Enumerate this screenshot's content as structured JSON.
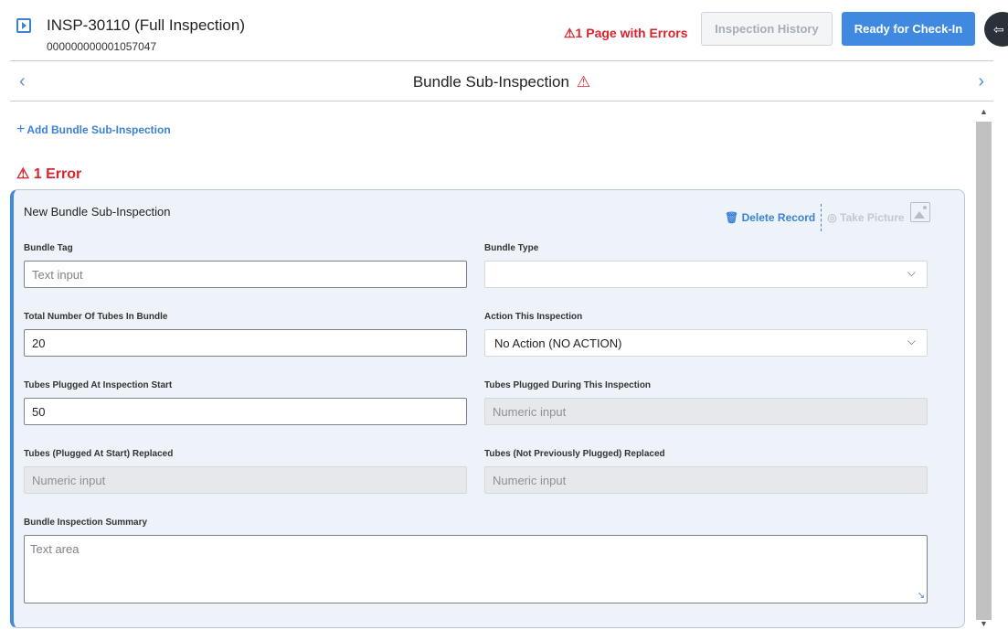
{
  "header": {
    "title": "INSP-30110 (Full Inspection)",
    "subtitle": "000000000001057047",
    "error_summary": "⚠1 Page with Errors",
    "history_button": "Inspection History",
    "ready_button": "Ready for Check-In"
  },
  "nav": {
    "prev": "‹",
    "next": "›",
    "title": "Bundle Sub-Inspection",
    "warning": "⚠"
  },
  "actions": {
    "add_plus": "+",
    "add_label": "Add Bundle Sub-Inspection"
  },
  "errors": {
    "count_label": "⚠ 1 Error"
  },
  "card": {
    "title": "New Bundle Sub-Inspection",
    "delete_label": "🗑 Delete Record",
    "picture_label": "◎ Take Picture"
  },
  "fields": {
    "bundle_tag": {
      "label": "Bundle Tag",
      "placeholder": "Text input"
    },
    "bundle_type": {
      "label": "Bundle Type",
      "value": ""
    },
    "total_tubes": {
      "label": "Total Number Of Tubes In Bundle",
      "value": "20"
    },
    "action": {
      "label": "Action This Inspection",
      "value": "No Action (NO ACTION)"
    },
    "plugged_start": {
      "label": "Tubes Plugged At Inspection Start",
      "value": "50"
    },
    "plugged_during": {
      "label": "Tubes Plugged During This Inspection",
      "placeholder": "Numeric input"
    },
    "replaced_plugged": {
      "label": "Tubes (Plugged At Start) Replaced",
      "placeholder": "Numeric input"
    },
    "replaced_not_plugged": {
      "label": "Tubes (Not Previously Plugged) Replaced",
      "placeholder": "Numeric input"
    },
    "summary": {
      "label": "Bundle Inspection Summary",
      "placeholder": "Text area"
    }
  },
  "icons": {
    "chevron": "⌵",
    "scroll_up": "▲",
    "scroll_down": "▼",
    "exit": "⇦"
  },
  "colors": {
    "accent": "#3f8ae0",
    "error": "#d9232d"
  }
}
